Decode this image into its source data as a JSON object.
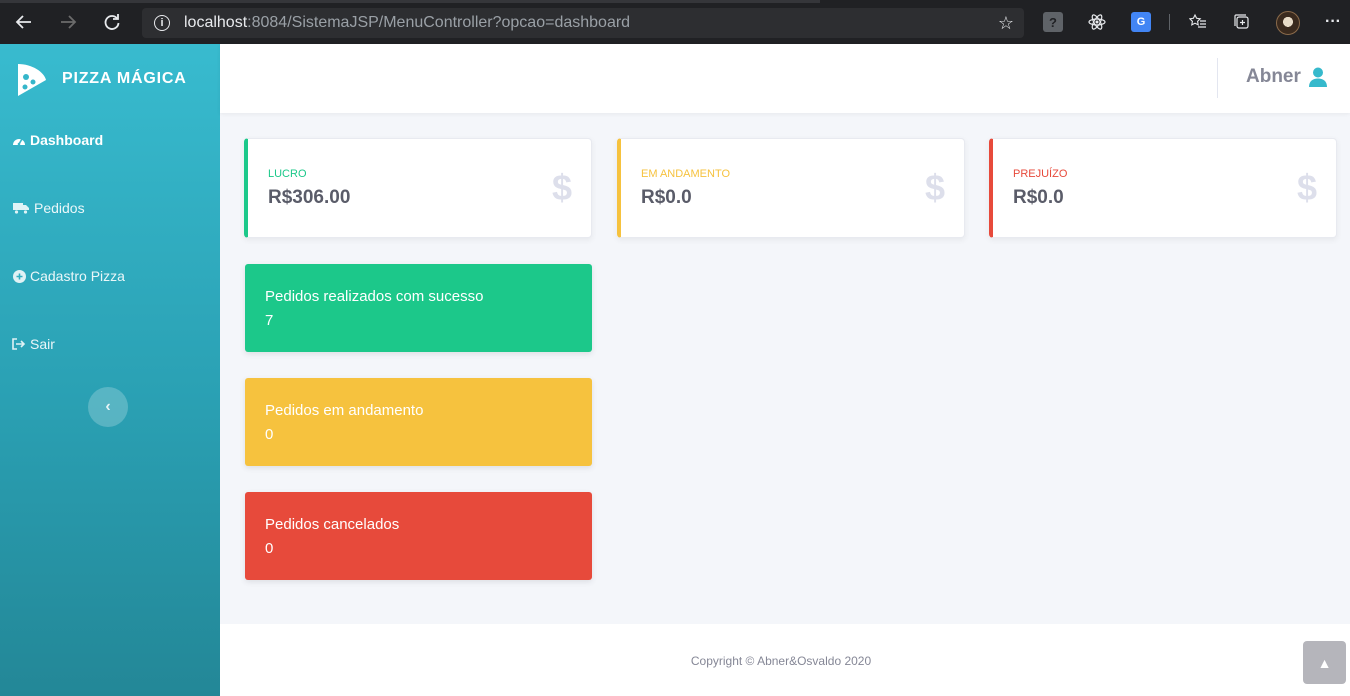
{
  "browser": {
    "url_host": "localhost",
    "url_rest": ":8084/SistemaJSP/MenuController?opcao=dashboard"
  },
  "sidebar": {
    "brand": "PIZZA MÁGICA",
    "items": [
      {
        "label": "Dashboard",
        "icon": "tachometer-icon"
      },
      {
        "label": "Pedidos",
        "icon": "truck-icon"
      },
      {
        "label": "Cadastro Pizza",
        "icon": "plus-circle-icon"
      },
      {
        "label": "Sair",
        "icon": "sign-out-icon"
      }
    ]
  },
  "topbar": {
    "user_name": "Abner"
  },
  "stats": [
    {
      "label": "LUCRO",
      "value": "R$306.00",
      "color": "#1cc88a"
    },
    {
      "label": "EM ANDAMENTO",
      "value": "R$0.0",
      "color": "#f6c23e"
    },
    {
      "label": "PREJUÍZO",
      "value": "R$0.0",
      "color": "#e74a3b"
    }
  ],
  "order_cards": [
    {
      "title": "Pedidos realizados com sucesso",
      "count": "7",
      "color": "#1cc88a"
    },
    {
      "title": "Pedidos em andamento",
      "count": "0",
      "color": "#f6c23e"
    },
    {
      "title": "Pedidos cancelados",
      "count": "0",
      "color": "#e74a3b"
    }
  ],
  "footer": {
    "copyright": "Copyright © Abner&Osvaldo 2020"
  }
}
